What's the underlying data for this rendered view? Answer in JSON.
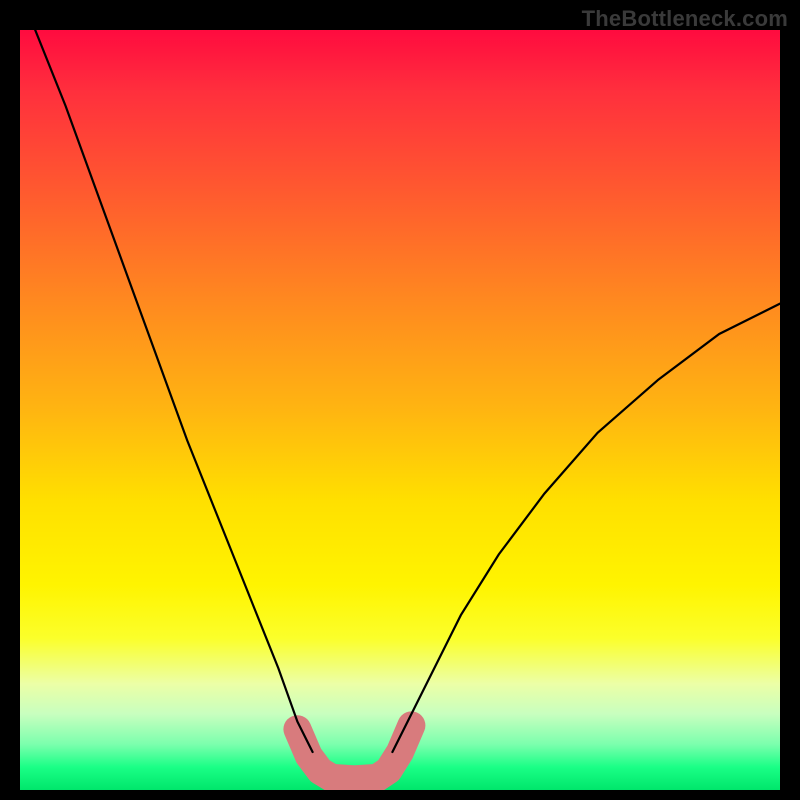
{
  "watermark": "TheBottleneck.com",
  "chart_data": {
    "type": "line",
    "title": "",
    "xlabel": "",
    "ylabel": "",
    "xlim": [
      0,
      100
    ],
    "ylim": [
      0,
      100
    ],
    "grid": false,
    "legend": false,
    "annotations": [],
    "series": [
      {
        "name": "curve-left",
        "stroke": "#000000",
        "stroke_width": 2,
        "x": [
          2,
          6,
          10,
          14,
          18,
          22,
          26,
          30,
          34,
          36.5,
          38.5
        ],
        "y": [
          100,
          90,
          79,
          68,
          57,
          46,
          36,
          26,
          16,
          9,
          5
        ]
      },
      {
        "name": "curve-right",
        "stroke": "#000000",
        "stroke_width": 2,
        "x": [
          49,
          51,
          54,
          58,
          63,
          69,
          76,
          84,
          92,
          100
        ],
        "y": [
          5,
          9,
          15,
          23,
          31,
          39,
          47,
          54,
          60,
          64
        ]
      },
      {
        "name": "highlight-band",
        "stroke": "#d87b7d",
        "stroke_width": 14,
        "linecap": "round",
        "x": [
          36.5,
          38,
          39.5,
          41,
          44,
          47,
          48.5,
          50,
          51.5
        ],
        "y": [
          8.0,
          4.5,
          2.5,
          1.6,
          1.4,
          1.6,
          2.6,
          5.0,
          8.5
        ]
      }
    ],
    "background_gradient": {
      "type": "vertical",
      "stops": [
        {
          "pos": 0.0,
          "color": "#ff0b3f"
        },
        {
          "pos": 0.08,
          "color": "#ff2f3d"
        },
        {
          "pos": 0.22,
          "color": "#ff5c2e"
        },
        {
          "pos": 0.36,
          "color": "#ff8a1f"
        },
        {
          "pos": 0.5,
          "color": "#ffb511"
        },
        {
          "pos": 0.62,
          "color": "#ffe000"
        },
        {
          "pos": 0.73,
          "color": "#fff400"
        },
        {
          "pos": 0.8,
          "color": "#fbff2a"
        },
        {
          "pos": 0.86,
          "color": "#ecffa6"
        },
        {
          "pos": 0.9,
          "color": "#c8ffbf"
        },
        {
          "pos": 0.94,
          "color": "#7bffad"
        },
        {
          "pos": 0.97,
          "color": "#1aff86"
        },
        {
          "pos": 1.0,
          "color": "#00e66b"
        }
      ]
    }
  }
}
